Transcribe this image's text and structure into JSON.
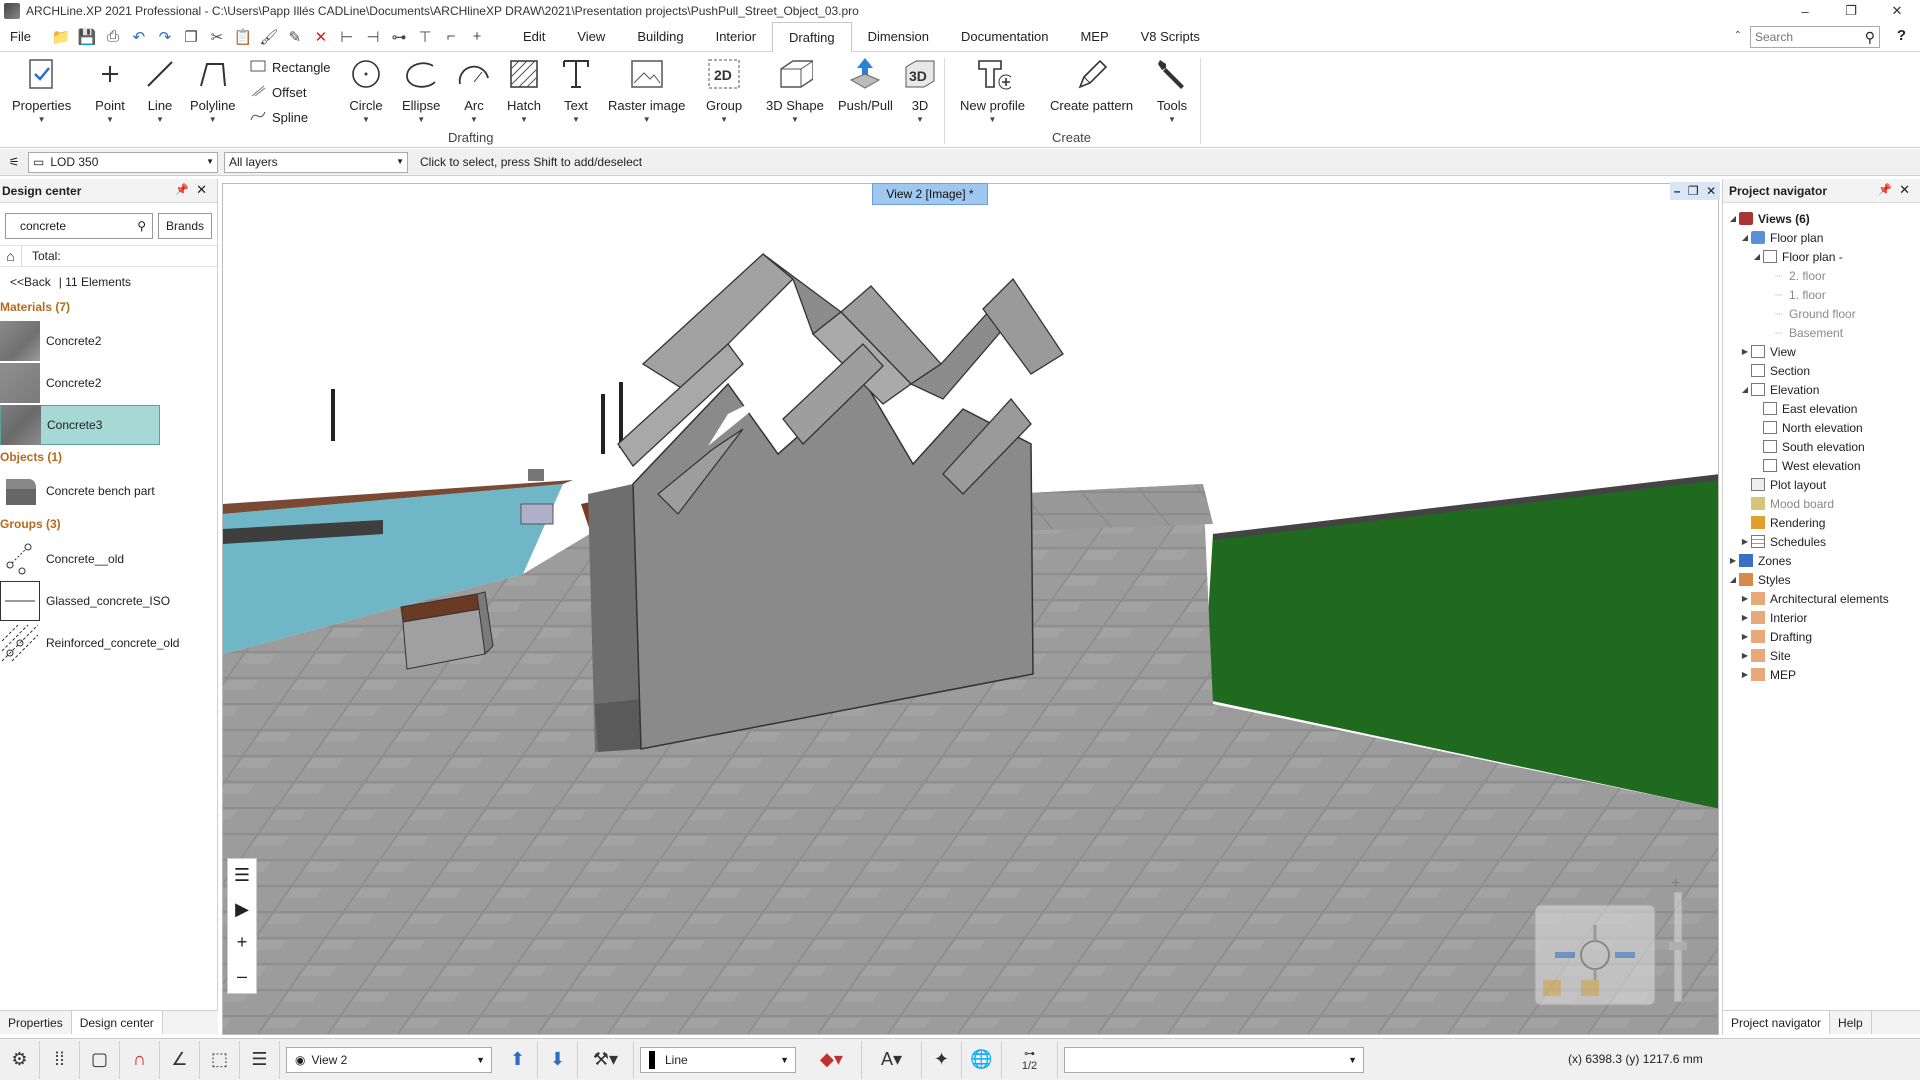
{
  "titlebar": {
    "title": "ARCHLine.XP 2021  Professional - C:\\Users\\Papp Illés CADLine\\Documents\\ARCHlineXP DRAW\\2021\\Presentation projects\\PushPull_Street_Object_03.pro",
    "minimize": "–",
    "restore": "❐",
    "close": "✕"
  },
  "menu": {
    "file": "File",
    "tabs": [
      "Edit",
      "View",
      "Building",
      "Interior",
      "Drafting",
      "Dimension",
      "Documentation",
      "MEP",
      "V8 Scripts"
    ],
    "active_tab": "Drafting",
    "search_placeholder": "Search",
    "help": "?"
  },
  "ribbon": {
    "properties": "Properties",
    "point": "Point",
    "line": "Line",
    "polyline": "Polyline",
    "rectangle": "Rectangle",
    "offset": "Offset",
    "spline": "Spline",
    "circle": "Circle",
    "ellipse": "Ellipse",
    "arc": "Arc",
    "hatch": "Hatch",
    "text": "Text",
    "raster_image": "Raster image",
    "group": "Group",
    "shape3d": "3D Shape",
    "pushpull": "Push/Pull",
    "threed": "3D",
    "new_profile": "New profile",
    "create_pattern": "Create pattern",
    "tools": "Tools",
    "group_drafting": "Drafting",
    "group_create": "Create"
  },
  "optbar": {
    "lod": "LOD 350",
    "layers": "All layers",
    "hint": "Click to select, press Shift to add/deselect"
  },
  "design_center": {
    "title": "Design center",
    "search_value": "concrete",
    "brands": "Brands",
    "total": "Total:",
    "back": "<<Back",
    "elements": "| 11 Elements",
    "materials_title": "Materials (7)",
    "materials": [
      "Concrete2",
      "Concrete2",
      "Concrete3"
    ],
    "objects_title": "Objects (1)",
    "objects": [
      "Concrete bench part"
    ],
    "groups_title": "Groups (3)",
    "groups": [
      "Concrete__old",
      "Glassed_concrete_ISO",
      "Reinforced_concrete_old"
    ],
    "tab_properties": "Properties",
    "tab_design_center": "Design center"
  },
  "viewport": {
    "tab_label": "View 2 [Image] *"
  },
  "project_navigator": {
    "title": "Project navigator",
    "views": "Views (6)",
    "floor_plan": "Floor plan",
    "floor_plan_sub": "Floor plan -",
    "floors": [
      "2. floor",
      "1. floor",
      "Ground floor",
      "Basement"
    ],
    "view": "View",
    "section": "Section",
    "elevation": "Elevation",
    "elevations": [
      "East elevation",
      "North elevation",
      "South elevation",
      "West elevation"
    ],
    "plot_layout": "Plot layout",
    "mood_board": "Mood board",
    "rendering": "Rendering",
    "schedules": "Schedules",
    "zones": "Zones",
    "styles": "Styles",
    "style_items": [
      "Architectural elements",
      "Interior",
      "Drafting",
      "Site",
      "MEP"
    ],
    "tab_navigator": "Project navigator",
    "tab_help": "Help"
  },
  "statusbar": {
    "view": "View 2",
    "line": "Line",
    "scale": "1/2",
    "coords": "(x) 6398.3  (y) 1217.6 mm"
  },
  "colors": {
    "accent": "#2b6cc4",
    "section_title": "#b56a1e",
    "selected_item": "#a6d9d6",
    "view_tab": "#9fc7ef"
  }
}
